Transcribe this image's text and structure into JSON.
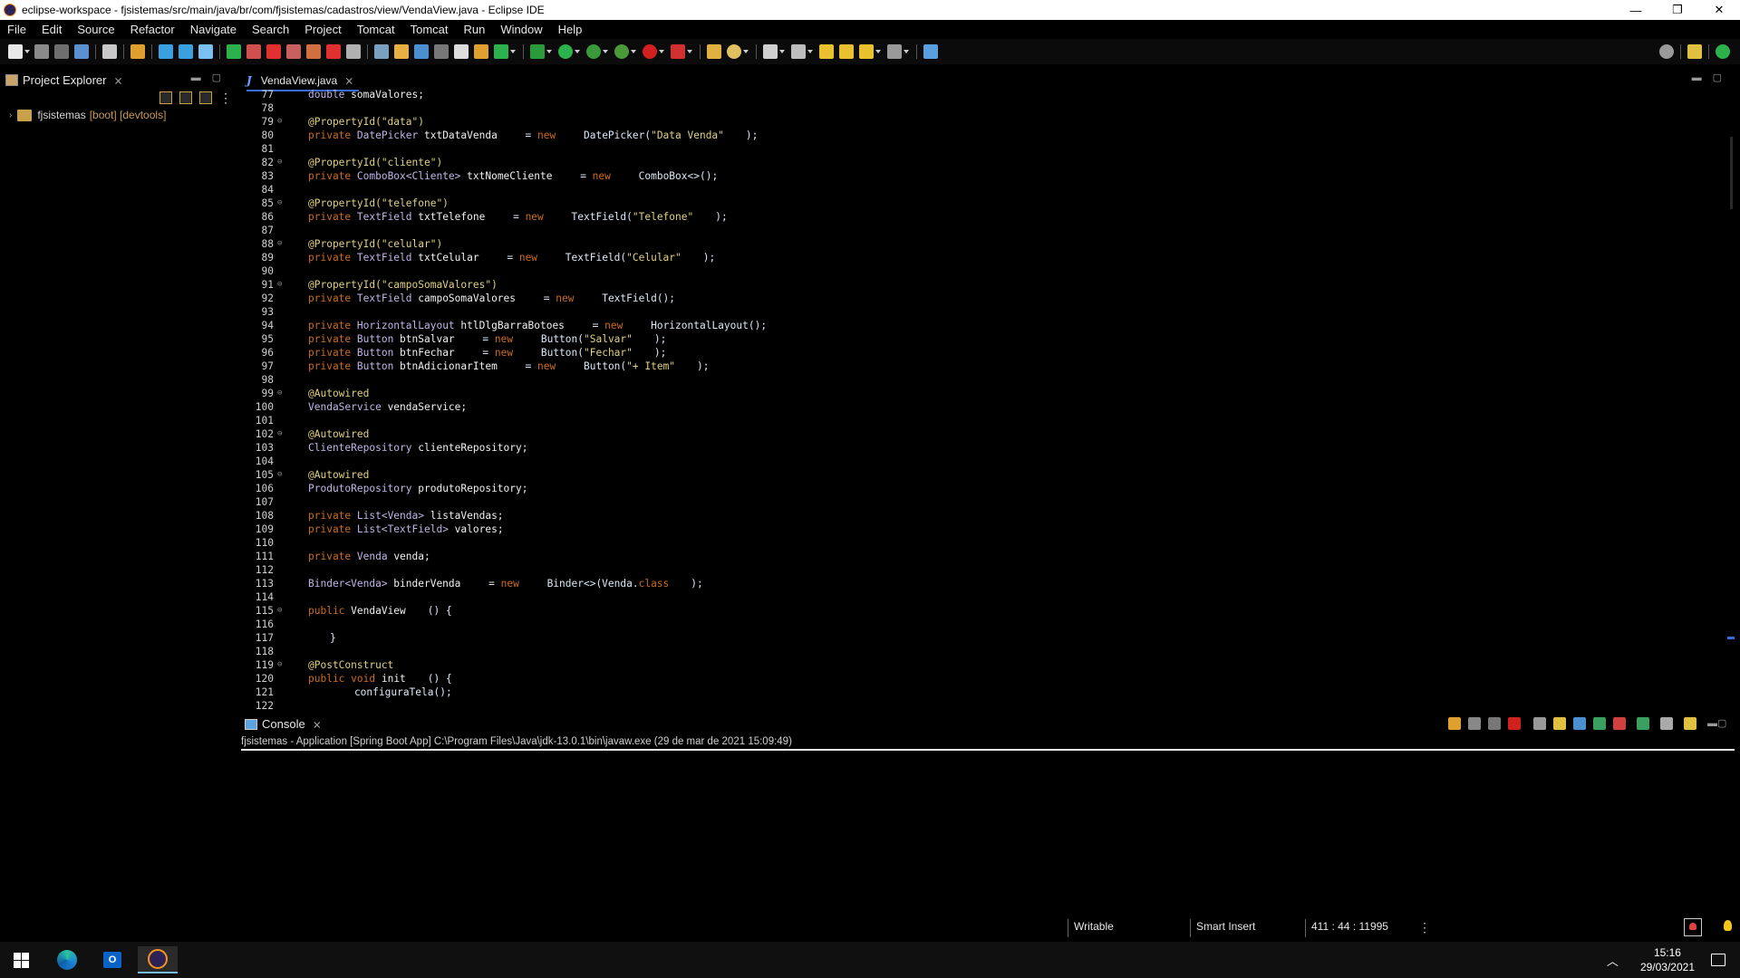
{
  "window": {
    "title": "eclipse-workspace - fjsistemas/src/main/java/br/com/fjsistemas/cadastros/view/VendaView.java - Eclipse IDE",
    "controls": [
      "—",
      "❐",
      "✕"
    ]
  },
  "menu": [
    "File",
    "Edit",
    "Source",
    "Refactor",
    "Navigate",
    "Search",
    "Project",
    "Tomcat",
    "Tomcat",
    "Run",
    "Window",
    "Help"
  ],
  "project_explorer": {
    "title": "Project Explorer",
    "project": {
      "name": "fjsistemas",
      "decoration": "[boot] [devtools]"
    }
  },
  "editor": {
    "tab_label": "VendaView.java",
    "tab_icon": "J",
    "lines": [
      {
        "n": "77",
        "fold": "",
        "t": [
          [
            "ty",
            "double"
          ],
          [
            "id",
            " somaValores;"
          ]
        ]
      },
      {
        "n": "78",
        "fold": "",
        "t": []
      },
      {
        "n": "79",
        "fold": "⊖",
        "t": [
          [
            "ann",
            "@PropertyId(\"data\")"
          ]
        ]
      },
      {
        "n": "80",
        "fold": "",
        "t": [
          [
            "kw",
            "private"
          ],
          [
            "ty",
            " DatePicker"
          ],
          [
            "id",
            " txtDataVenda"
          ],
          [
            "src",
            " = "
          ],
          [
            "kw",
            "new"
          ],
          [
            "src",
            " DatePicker("
          ],
          [
            "str",
            "\"Data Venda\""
          ],
          [
            "src",
            ");"
          ]
        ]
      },
      {
        "n": "81",
        "fold": "",
        "t": []
      },
      {
        "n": "82",
        "fold": "⊖",
        "t": [
          [
            "ann",
            "@PropertyId(\"cliente\")"
          ]
        ]
      },
      {
        "n": "83",
        "fold": "",
        "t": [
          [
            "kw",
            "private"
          ],
          [
            "ty",
            " ComboBox<Cliente>"
          ],
          [
            "id",
            " txtNomeCliente"
          ],
          [
            "src",
            " = "
          ],
          [
            "kw",
            "new"
          ],
          [
            "src",
            " ComboBox<>();"
          ]
        ]
      },
      {
        "n": "84",
        "fold": "",
        "t": []
      },
      {
        "n": "85",
        "fold": "⊖",
        "t": [
          [
            "ann",
            "@PropertyId(\"telefone\")"
          ]
        ]
      },
      {
        "n": "86",
        "fold": "",
        "t": [
          [
            "kw",
            "private"
          ],
          [
            "ty",
            " TextField"
          ],
          [
            "id",
            " txtTelefone"
          ],
          [
            "src",
            " = "
          ],
          [
            "kw",
            "new"
          ],
          [
            "src",
            " TextField("
          ],
          [
            "str",
            "\"Telefone\""
          ],
          [
            "src",
            ");"
          ]
        ]
      },
      {
        "n": "87",
        "fold": "",
        "t": []
      },
      {
        "n": "88",
        "fold": "⊖",
        "t": [
          [
            "ann",
            "@PropertyId(\"celular\")"
          ]
        ]
      },
      {
        "n": "89",
        "fold": "",
        "t": [
          [
            "kw",
            "private"
          ],
          [
            "ty",
            " TextField"
          ],
          [
            "id",
            " txtCelular"
          ],
          [
            "src",
            " = "
          ],
          [
            "kw",
            "new"
          ],
          [
            "src",
            " TextField("
          ],
          [
            "str",
            "\"Celular\""
          ],
          [
            "src",
            ");"
          ]
        ]
      },
      {
        "n": "90",
        "fold": "",
        "t": []
      },
      {
        "n": "91",
        "fold": "⊖",
        "t": [
          [
            "ann",
            "@PropertyId(\"campoSomaValores\")"
          ]
        ]
      },
      {
        "n": "92",
        "fold": "",
        "t": [
          [
            "kw",
            "private"
          ],
          [
            "ty",
            " TextField"
          ],
          [
            "id",
            " campoSomaValores"
          ],
          [
            "src",
            " = "
          ],
          [
            "kw",
            "new"
          ],
          [
            "src",
            " TextField();"
          ]
        ]
      },
      {
        "n": "93",
        "fold": "",
        "t": []
      },
      {
        "n": "94",
        "fold": "",
        "t": [
          [
            "kw",
            "private"
          ],
          [
            "ty",
            " HorizontalLayout"
          ],
          [
            "id",
            " htlDlgBarraBotoes"
          ],
          [
            "src",
            " = "
          ],
          [
            "kw",
            "new"
          ],
          [
            "src",
            " HorizontalLayout();"
          ]
        ]
      },
      {
        "n": "95",
        "fold": "",
        "t": [
          [
            "kw",
            "private"
          ],
          [
            "ty",
            " Button"
          ],
          [
            "id",
            " btnSalvar"
          ],
          [
            "src",
            " = "
          ],
          [
            "kw",
            "new"
          ],
          [
            "src",
            " Button("
          ],
          [
            "str",
            "\"Salvar\""
          ],
          [
            "src",
            ");"
          ]
        ]
      },
      {
        "n": "96",
        "fold": "",
        "t": [
          [
            "kw",
            "private"
          ],
          [
            "ty",
            " Button"
          ],
          [
            "id",
            " btnFechar"
          ],
          [
            "src",
            " = "
          ],
          [
            "kw",
            "new"
          ],
          [
            "src",
            " Button("
          ],
          [
            "str",
            "\"Fechar\""
          ],
          [
            "src",
            ");"
          ]
        ]
      },
      {
        "n": "97",
        "fold": "",
        "t": [
          [
            "kw",
            "private"
          ],
          [
            "ty",
            " Button"
          ],
          [
            "id",
            " btnAdicionarItem"
          ],
          [
            "src",
            " = "
          ],
          [
            "kw",
            "new"
          ],
          [
            "src",
            " Button("
          ],
          [
            "str",
            "\"+ Item\""
          ],
          [
            "src",
            ");"
          ]
        ]
      },
      {
        "n": "98",
        "fold": "",
        "t": []
      },
      {
        "n": "99",
        "fold": "⊖",
        "t": [
          [
            "ann",
            "@Autowired"
          ]
        ]
      },
      {
        "n": "100",
        "fold": "",
        "t": [
          [
            "ty",
            "VendaService"
          ],
          [
            "id",
            " vendaService;"
          ]
        ]
      },
      {
        "n": "101",
        "fold": "",
        "t": []
      },
      {
        "n": "102",
        "fold": "⊖",
        "t": [
          [
            "ann",
            "@Autowired"
          ]
        ]
      },
      {
        "n": "103",
        "fold": "",
        "t": [
          [
            "ty",
            "ClienteRepository"
          ],
          [
            "id",
            " clienteRepository;"
          ]
        ]
      },
      {
        "n": "104",
        "fold": "",
        "t": []
      },
      {
        "n": "105",
        "fold": "⊖",
        "t": [
          [
            "ann",
            "@Autowired"
          ]
        ]
      },
      {
        "n": "106",
        "fold": "",
        "t": [
          [
            "ty",
            "ProdutoRepository"
          ],
          [
            "id",
            " produtoRepository;"
          ]
        ]
      },
      {
        "n": "107",
        "fold": "",
        "t": []
      },
      {
        "n": "108",
        "fold": "",
        "t": [
          [
            "kw",
            "private"
          ],
          [
            "ty",
            " List<Venda>"
          ],
          [
            "id",
            " listaVendas;"
          ]
        ]
      },
      {
        "n": "109",
        "fold": "",
        "t": [
          [
            "kw",
            "private"
          ],
          [
            "ty",
            " List<TextField>"
          ],
          [
            "id",
            " valores;"
          ]
        ]
      },
      {
        "n": "110",
        "fold": "",
        "t": []
      },
      {
        "n": "111",
        "fold": "",
        "t": [
          [
            "kw",
            "private"
          ],
          [
            "ty",
            " Venda"
          ],
          [
            "id",
            " venda;"
          ]
        ]
      },
      {
        "n": "112",
        "fold": "",
        "t": []
      },
      {
        "n": "113",
        "fold": "",
        "t": [
          [
            "ty",
            "Binder<Venda>"
          ],
          [
            "id",
            " binderVenda"
          ],
          [
            "src",
            " = "
          ],
          [
            "kw",
            "new"
          ],
          [
            "src",
            " Binder<>(Venda."
          ],
          [
            "kw",
            "class"
          ],
          [
            "src",
            ");"
          ]
        ]
      },
      {
        "n": "114",
        "fold": "",
        "t": []
      },
      {
        "n": "115",
        "fold": "⊖",
        "t": [
          [
            "kw",
            "public"
          ],
          [
            "id",
            " VendaView"
          ],
          [
            "src",
            "() {"
          ]
        ]
      },
      {
        "n": "116",
        "fold": "",
        "t": []
      },
      {
        "n": "117",
        "fold": "",
        "t": [
          [
            "src",
            "}"
          ]
        ]
      },
      {
        "n": "118",
        "fold": "",
        "t": []
      },
      {
        "n": "119",
        "fold": "⊖",
        "t": [
          [
            "ann",
            "@PostConstruct"
          ]
        ]
      },
      {
        "n": "120",
        "fold": "",
        "t": [
          [
            "kw",
            "public"
          ],
          [
            "kw",
            " void"
          ],
          [
            "id",
            " init"
          ],
          [
            "src",
            "() {"
          ]
        ]
      },
      {
        "n": "121",
        "fold": "",
        "t": [
          [
            "src",
            "    configuraTela();"
          ]
        ]
      },
      {
        "n": "122",
        "fold": "",
        "t": []
      }
    ]
  },
  "console": {
    "title": "Console",
    "launch": "fjsistemas - Application [Spring Boot App] C:\\Program Files\\Java\\jdk-13.0.1\\bin\\javaw.exe  (29 de mar de 2021 15:09:49)"
  },
  "status": {
    "writable": "Writable",
    "insert_mode": "Smart Insert",
    "position": "411 : 44 : 11995"
  },
  "taskbar": {
    "time": "15:16",
    "date": "29/03/2021"
  },
  "colors": {
    "keyword": "#cc6c1d",
    "annotation": "#e0d17e",
    "type": "#c2b3e8",
    "identifier": "#f0f0f0",
    "accent": "#3a6bd8"
  }
}
